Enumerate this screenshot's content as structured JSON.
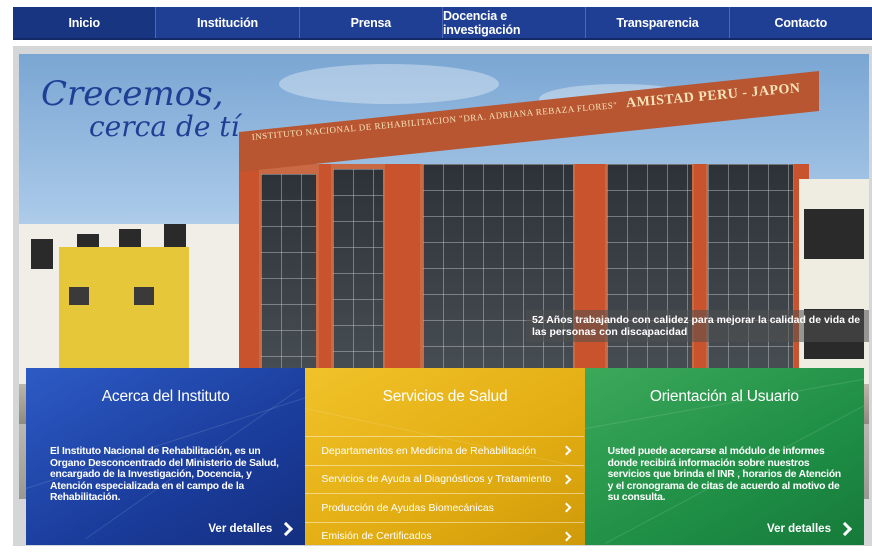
{
  "nav": {
    "items": [
      {
        "label": "Inicio"
      },
      {
        "label": "Institución"
      },
      {
        "label": "Prensa"
      },
      {
        "label": "Docencia e investigación"
      },
      {
        "label": "Transparencia"
      },
      {
        "label": "Contacto"
      }
    ]
  },
  "hero": {
    "slogan_line1": "Crecemos,",
    "slogan_line2": "cerca de tí",
    "building_sign": "INSTITUTO NACIONAL DE REHABILITACION \"DRA. ADRIANA REBAZA FLORES\"",
    "building_sign_big": "AMISTAD PERU - JAPON",
    "caption": "52 Años trabajando con calidez para mejorar la calidad de vida de las personas con discapacidad"
  },
  "panels": {
    "about": {
      "title": "Acerca del Instituto",
      "text": "El Instituto Nacional de Rehabilitación, es un Organo Desconcentrado del Ministerio de Salud, encargado de la Investigación, Docencia, y Atención especializada en el campo de la Rehabilitación.",
      "more": "Ver detalles"
    },
    "services": {
      "title": "Servicios de Salud",
      "items": [
        {
          "label": "Departamentos en Medicina de Rehabilitación"
        },
        {
          "label": "Servicios de Ayuda al Diagnósticos y Tratamiento"
        },
        {
          "label": "Producción de Ayudas Biomecánicas"
        },
        {
          "label": "Emisión de Certificados"
        }
      ]
    },
    "orientation": {
      "title": "Orientación al Usuario",
      "text": "Usted puede acercarse al módulo de informes donde recibirá información sobre nuestros servicios que brinda el INR , horarios de Atención y el cronograma de citas de acuerdo al motivo de su consulta.",
      "more": "Ver detalles"
    }
  },
  "colors": {
    "nav": "#1f3f95",
    "blue_panel": "#1a3c9b",
    "yellow_panel": "#e2ad12",
    "green_panel": "#1f8f46"
  }
}
